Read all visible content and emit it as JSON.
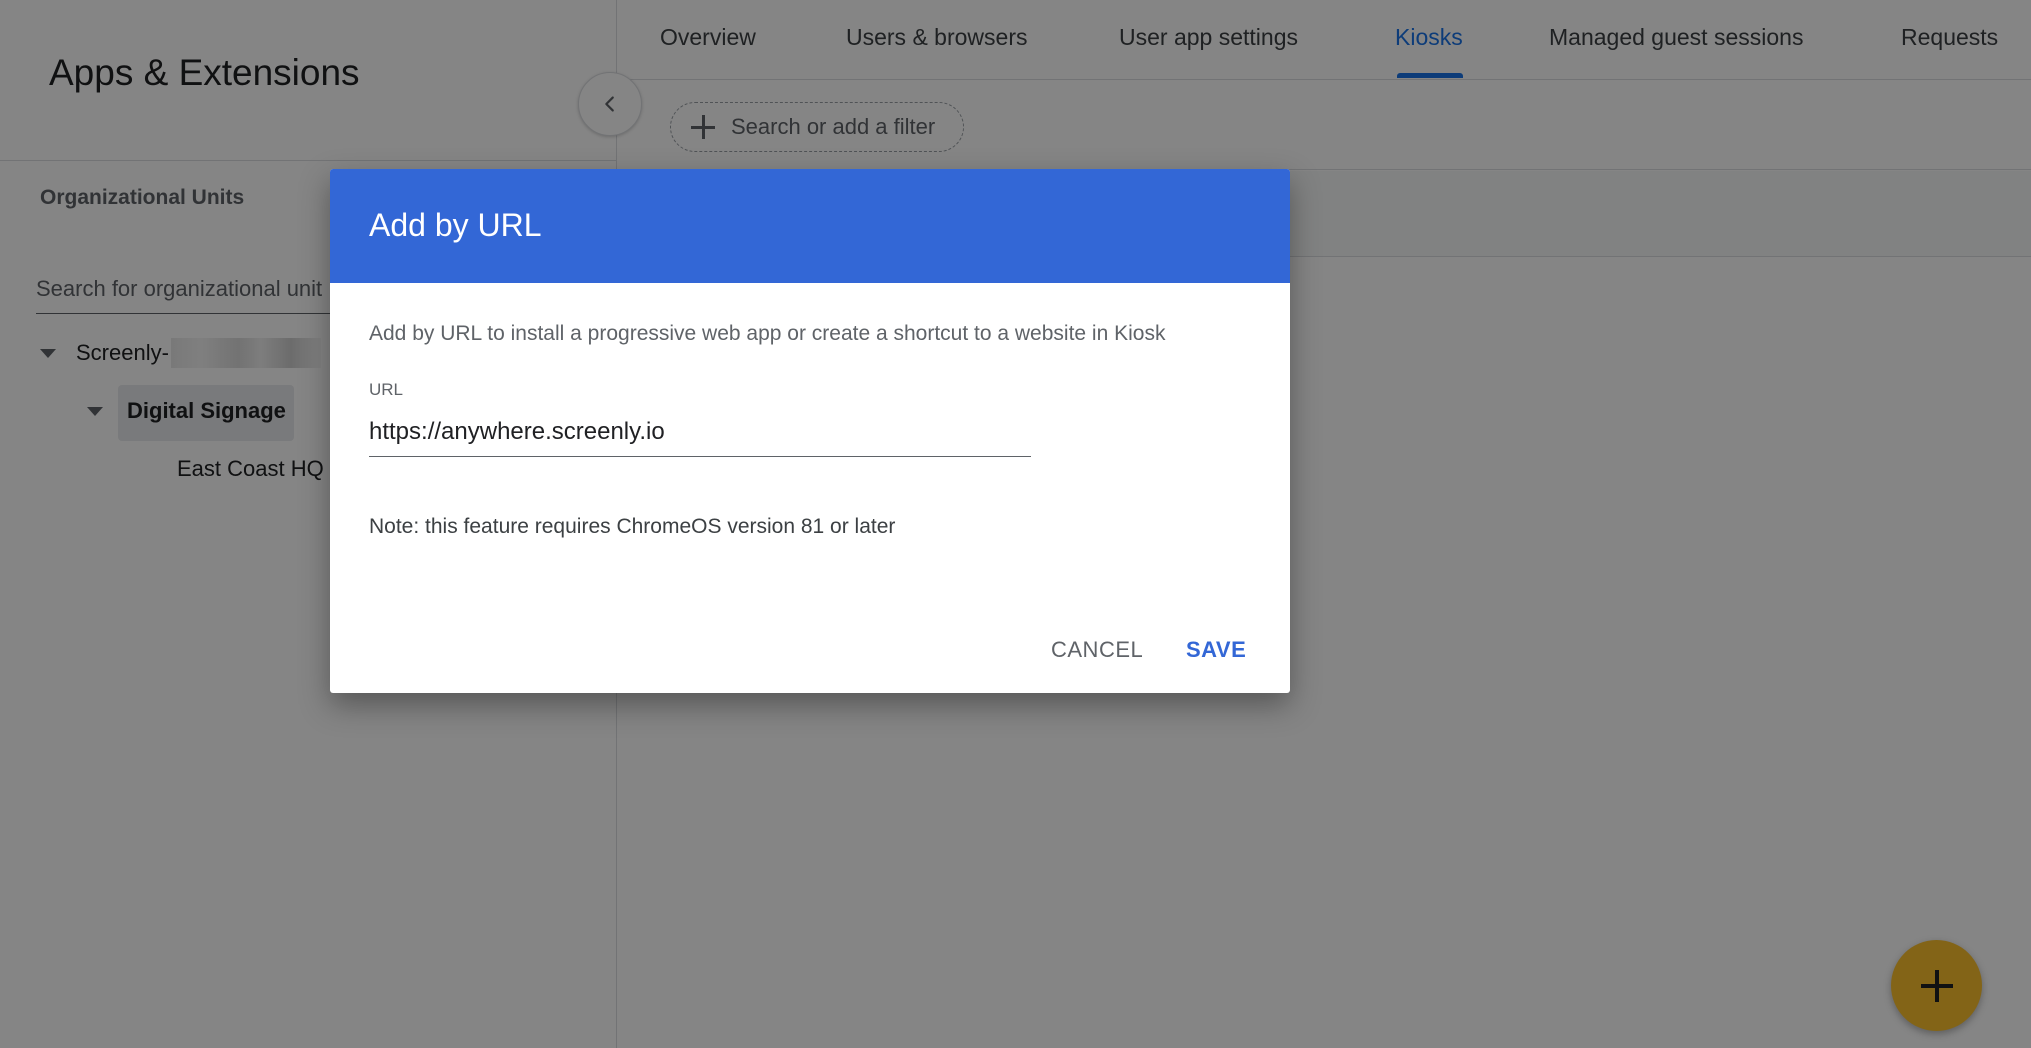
{
  "page": {
    "title": "Apps & Extensions"
  },
  "sidebar": {
    "section_label": "Organizational Units",
    "search_placeholder": "Search for organizational unit",
    "tree": [
      {
        "label": "Screenly-"
      },
      {
        "label": "Digital Signage"
      },
      {
        "label": "East Coast HQ"
      }
    ]
  },
  "tabs": [
    {
      "label": "Overview"
    },
    {
      "label": "Users & browsers"
    },
    {
      "label": "User app settings"
    },
    {
      "label": "Kiosks"
    },
    {
      "label": "Managed guest sessions"
    },
    {
      "label": "Requests"
    }
  ],
  "active_tab": "Kiosks",
  "filter": {
    "placeholder": "Search or add a filter"
  },
  "dialog": {
    "title": "Add by URL",
    "description": "Add by URL to install a progressive web app or create a shortcut to a website in Kiosk",
    "url_label": "URL",
    "url_value": "https://anywhere.screenly.io",
    "note": "Note: this feature requires ChromeOS version 81 or later",
    "cancel_label": "CANCEL",
    "save_label": "SAVE"
  },
  "colors": {
    "dialog_header": "#3367d6",
    "active_tab": "#1a73e8",
    "fab": "#fbc02d"
  },
  "icons": {
    "collapse": "chevron-left-icon",
    "filter_add": "plus-icon",
    "tree_toggle": "caret-down-icon",
    "fab": "plus-icon"
  }
}
